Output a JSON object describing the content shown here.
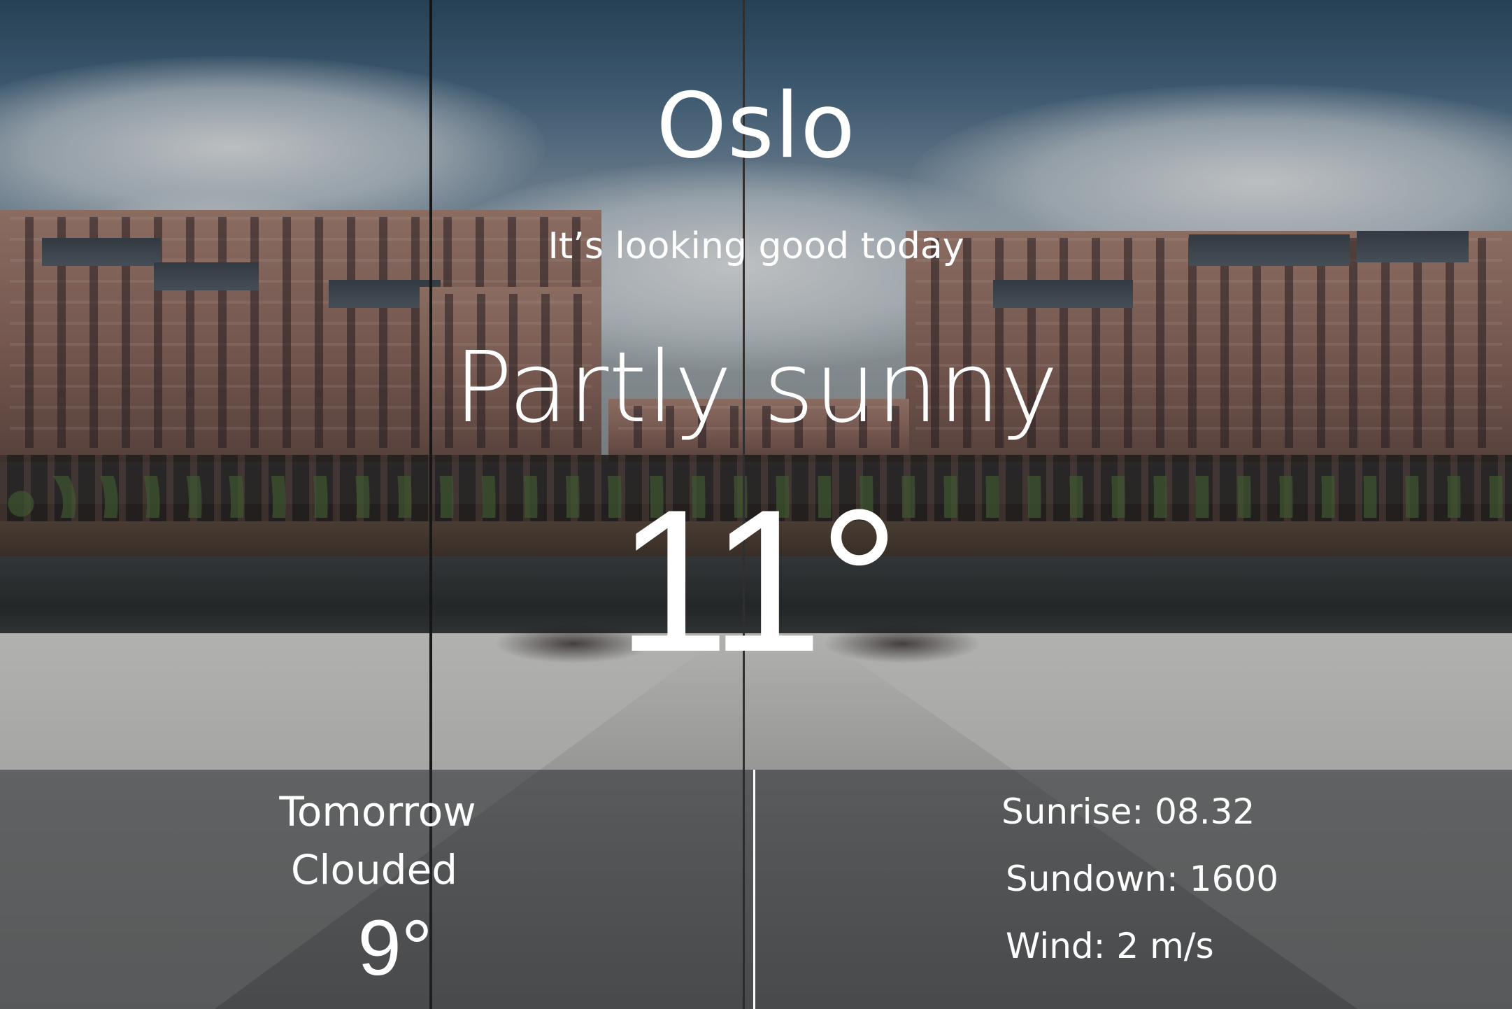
{
  "current": {
    "city": "Oslo",
    "tagline": "It’s looking good today",
    "condition": "Partly sunny",
    "temperature": "11°"
  },
  "tomorrow": {
    "label": "Tomorrow",
    "condition": "Clouded",
    "temperature": "9°"
  },
  "details": {
    "sunrise": "Sunrise: 08.32",
    "sundown": "Sundown: 1600",
    "wind": "Wind: 2 m/s"
  },
  "colors": {
    "text": "#ffffff",
    "panel": "#282a2d"
  }
}
